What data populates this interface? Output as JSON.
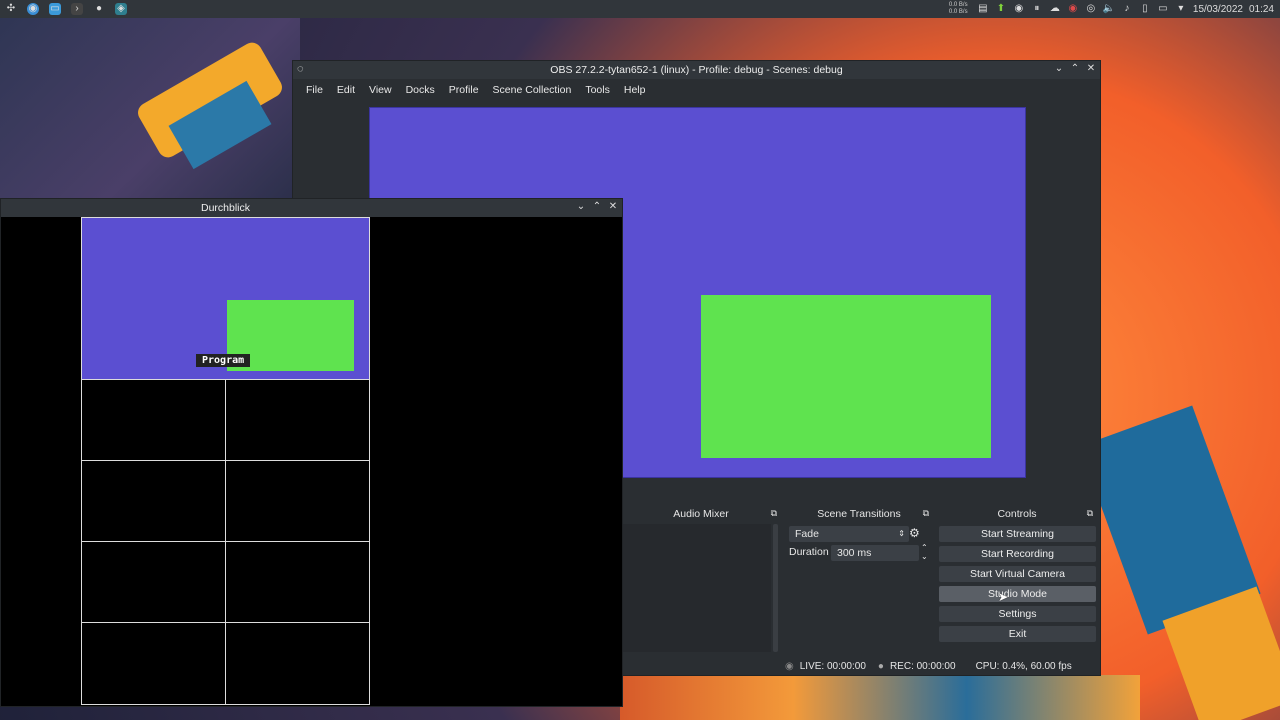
{
  "panel": {
    "net_up": "0.0 B/s",
    "net_down": "0.0 B/s",
    "date": "15/03/2022",
    "time": "01:24"
  },
  "obs": {
    "title": "OBS 27.2.2-tytan652-1 (linux) - Profile: debug - Scenes: debug",
    "menu": [
      "File",
      "Edit",
      "View",
      "Docks",
      "Profile",
      "Scene Collection",
      "Tools",
      "Help"
    ],
    "audio_mixer": "Audio Mixer",
    "scene_transitions": {
      "title": "Scene Transitions",
      "transition": "Fade",
      "duration_label": "Duration",
      "duration_value": "300 ms"
    },
    "controls": {
      "title": "Controls",
      "buttons": [
        "Start Streaming",
        "Start Recording",
        "Start Virtual Camera",
        "Studio Mode",
        "Settings",
        "Exit"
      ]
    },
    "status": {
      "live": "LIVE: 00:00:00",
      "rec": "REC: 00:00:00",
      "cpu": "CPU: 0.4%, 60.00 fps"
    },
    "colors": {
      "scene_bg": "#5b4fd1",
      "source": "#5fe34f"
    }
  },
  "multiview": {
    "title": "Durchblick",
    "program_label": "Program"
  }
}
